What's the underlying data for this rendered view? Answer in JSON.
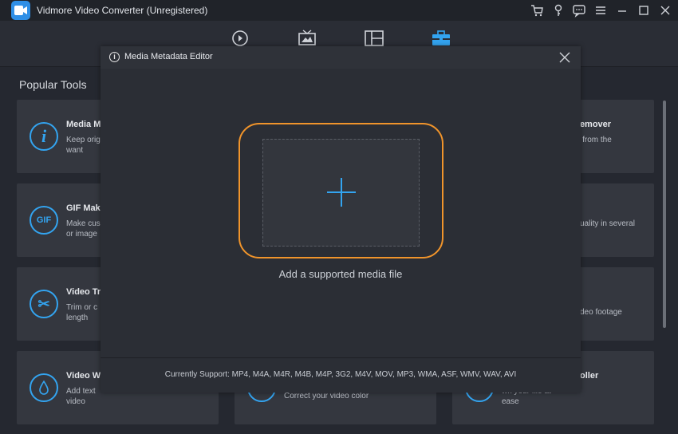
{
  "app": {
    "title": "Vidmore Video Converter (Unregistered)"
  },
  "window_controls": [
    "cart-icon",
    "key-icon",
    "feedback-icon",
    "menu-icon",
    "minimize-icon",
    "maximize-icon",
    "close-icon"
  ],
  "nav": {
    "items": [
      "converter-icon",
      "mv-icon",
      "collage-icon",
      "toolbox-icon"
    ],
    "active": "toolbox-icon"
  },
  "popular_tools": {
    "title": "Popular Tools",
    "cards": [
      {
        "title": "Media M",
        "desc": "Keep orig\nwant",
        "icon": "info-icon",
        "glyph": "i"
      },
      {
        "title": "GIF Mak",
        "desc": "Make cus\nor image",
        "icon": "gif-icon",
        "glyph": "GIF"
      },
      {
        "title": "Video Tr",
        "desc": "Trim or c\nlength",
        "icon": "scissors-icon",
        "glyph": "✂"
      },
      {
        "title": "Video W",
        "desc": "Add text\nvideo",
        "icon": "droplet-icon",
        "glyph": "💧"
      }
    ],
    "middle_cards": [
      {
        "desc": "Correct your video color"
      }
    ],
    "right_cards": [
      {
        "title": "Remover",
        "desc": "rk from the"
      },
      {
        "title": "",
        "desc": "uality in several"
      },
      {
        "title": "",
        "desc": "deo footage"
      },
      {
        "title": "oller",
        "desc": "wn your file at\nease"
      }
    ]
  },
  "modal": {
    "title": "Media Metadata Editor",
    "drop_label": "Add a supported media file",
    "support_text": "Currently Support: MP4, M4A, M4R, M4B, M4P, 3G2, M4V, MOV, MP3, WMA, ASF, WMV, WAV, AVI"
  },
  "colors": {
    "accent_blue": "#33a4f0",
    "accent_orange": "#f0942b",
    "background": "#252830"
  }
}
